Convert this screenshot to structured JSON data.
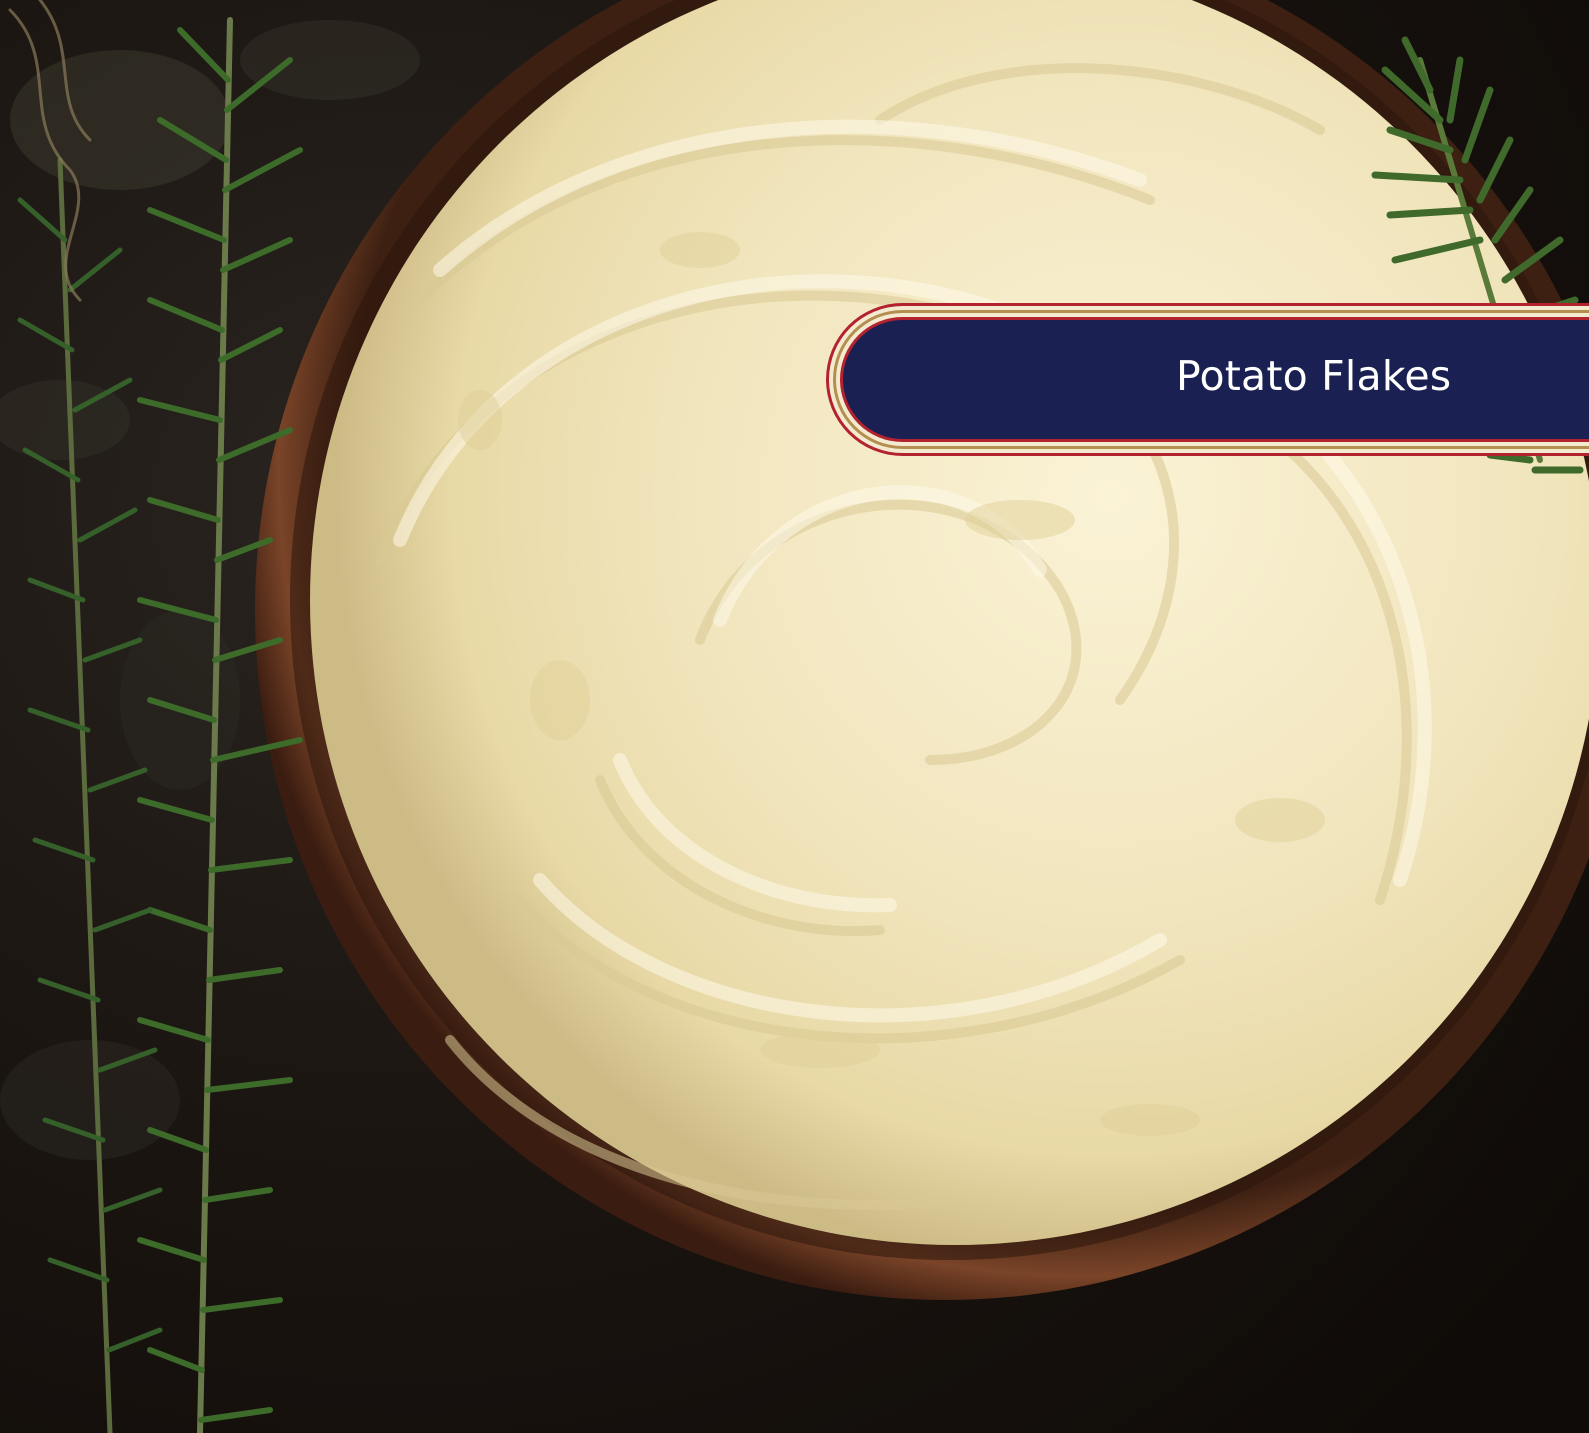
{
  "label": {
    "text": "Potato Flakes"
  },
  "colors": {
    "banner_fill": "#1a2152",
    "banner_red_outline": "#b3232f",
    "banner_gold_outline": "#b48e4f",
    "mash": "#f2e7c2",
    "bowl": "#6b3a22",
    "rosemary": "#3f6a2c",
    "background": "#15100c"
  },
  "icons": [
    "rosemary-sprig-icon",
    "bowl-icon"
  ]
}
